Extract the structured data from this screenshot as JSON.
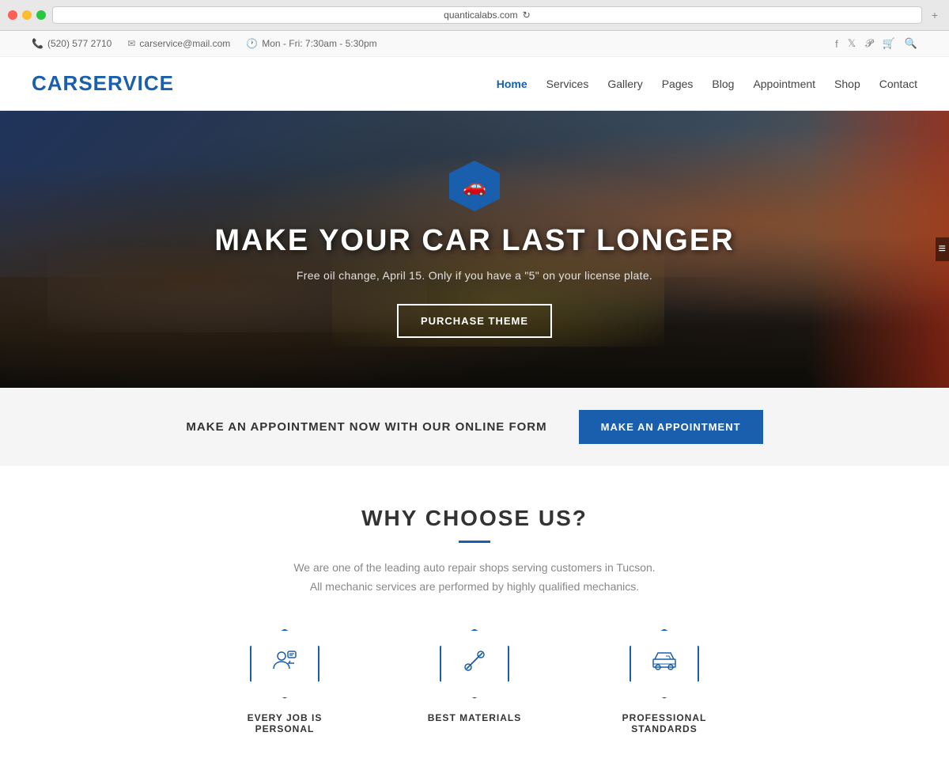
{
  "browser": {
    "url": "quanticalabs.com",
    "reload_icon": "↻"
  },
  "topbar": {
    "phone": "(520) 577 2710",
    "email": "carservice@mail.com",
    "hours": "Mon - Fri: 7:30am - 5:30pm",
    "phone_icon": "📞",
    "email_icon": "✉",
    "clock_icon": "🕐"
  },
  "navbar": {
    "logo": "CARSERVICE",
    "links": [
      {
        "label": "Home",
        "active": true
      },
      {
        "label": "Services",
        "active": false
      },
      {
        "label": "Gallery",
        "active": false
      },
      {
        "label": "Pages",
        "active": false
      },
      {
        "label": "Blog",
        "active": false
      },
      {
        "label": "Appointment",
        "active": false
      },
      {
        "label": "Shop",
        "active": false
      },
      {
        "label": "Contact",
        "active": false
      }
    ]
  },
  "hero": {
    "icon": "🚗",
    "title": "MAKE YOUR CAR LAST LONGER",
    "subtitle": "Free oil change, April 15. Only if you have a \"5\" on your license plate.",
    "cta_label": "PURCHASE THEME"
  },
  "appointment_banner": {
    "text": "MAKE AN APPOINTMENT NOW WITH OUR ONLINE FORM",
    "btn_label": "MAKE AN APPOINTMENT"
  },
  "why_section": {
    "title": "WHY CHOOSE US?",
    "description_line1": "We are one of the leading auto repair shops serving customers in Tucson.",
    "description_line2": "All mechanic services are performed by highly qualified mechanics.",
    "features": [
      {
        "label": "EVERY JOB IS PERSONAL",
        "icon": "👤"
      },
      {
        "label": "BEST MATERIALS",
        "icon": "🔧"
      },
      {
        "label": "PROFESSIONAL STANDARDS",
        "icon": "🚛"
      }
    ]
  },
  "colors": {
    "brand_blue": "#1a5fad",
    "text_dark": "#333333",
    "text_gray": "#888888",
    "bg_light": "#f5f5f5"
  }
}
